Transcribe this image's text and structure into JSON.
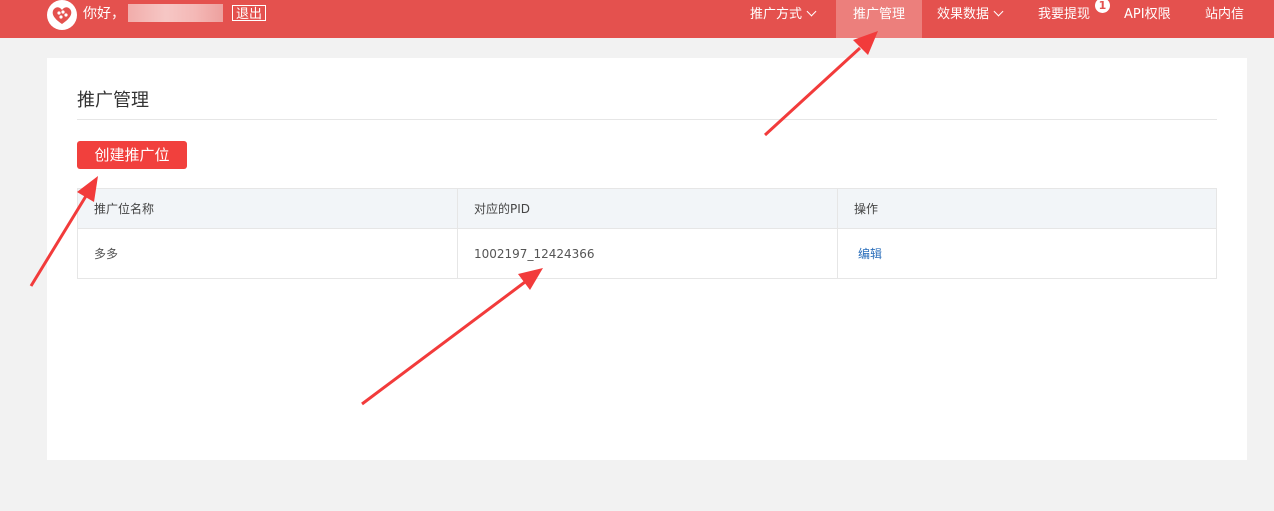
{
  "header": {
    "greeting": "你好，",
    "logout_label": "退出",
    "nav": [
      {
        "label": "推广方式",
        "dropdown": true
      },
      {
        "label": "推广管理",
        "active": true
      },
      {
        "label": "效果数据",
        "dropdown": true
      },
      {
        "label": "我要提现",
        "badge": "1"
      },
      {
        "label": "API权限"
      },
      {
        "label": "站内信"
      }
    ]
  },
  "main": {
    "title": "推广管理",
    "create_button": "创建推广位",
    "table": {
      "columns": [
        "推广位名称",
        "对应的PID",
        "操作"
      ],
      "rows": [
        {
          "name": "多多",
          "pid": "1002197_12424366",
          "action": "编辑"
        }
      ]
    }
  },
  "colors": {
    "brand": "#e4514e",
    "button": "#f1403d",
    "link": "#2a6ebb",
    "arrow": "#f23b3b"
  },
  "icons": {
    "logo": "pinduoduo-logo-icon",
    "arrow": "annotation-arrow-icon"
  }
}
